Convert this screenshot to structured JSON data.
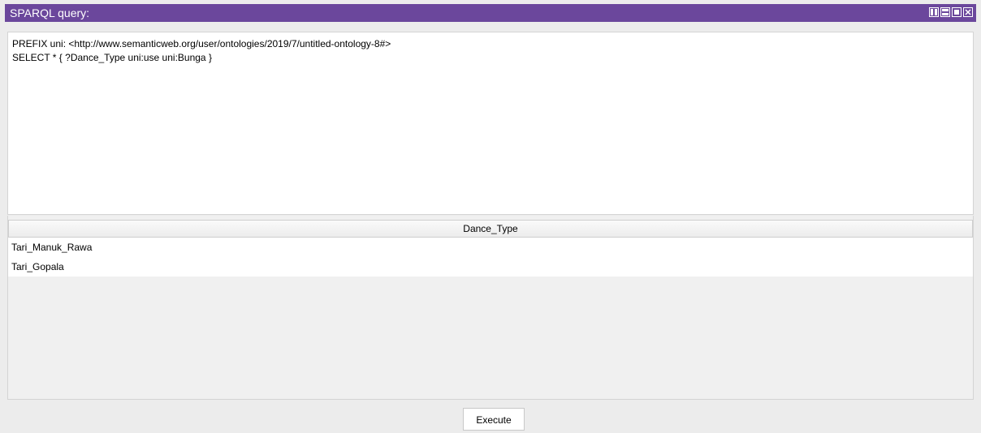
{
  "window": {
    "title": "SPARQL query:",
    "title_buttons": [
      "split-vertical-icon",
      "split-horizontal-icon",
      "maximize-icon",
      "close-icon"
    ],
    "accent_color": "#6b479c"
  },
  "query": {
    "lines": [
      "PREFIX uni: <http://www.semanticweb.org/user/ontologies/2019/7/untitled-ontology-8#>",
      "SELECT * { ?Dance_Type uni:use uni:Bunga }"
    ]
  },
  "results": {
    "columns": [
      "Dance_Type"
    ],
    "rows": [
      [
        "Tari_Manuk_Rawa"
      ],
      [
        "Tari_Gopala"
      ]
    ]
  },
  "actions": {
    "execute_label": "Execute"
  }
}
